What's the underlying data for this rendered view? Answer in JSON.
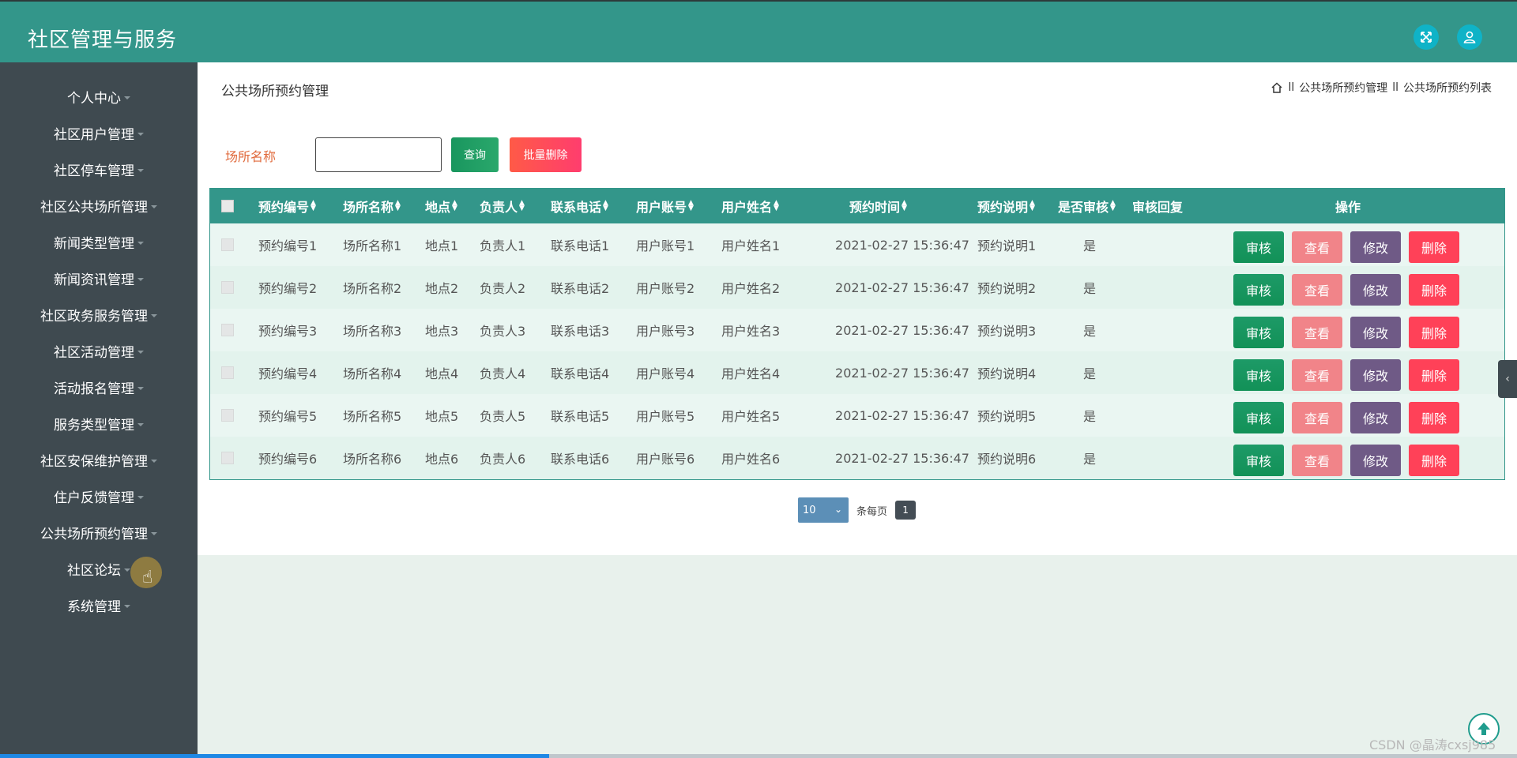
{
  "app": {
    "title": "社区管理与服务"
  },
  "header": {
    "icons": [
      "fullscreen-icon",
      "user-icon"
    ]
  },
  "sidebar": {
    "items": [
      {
        "label": "个人中心"
      },
      {
        "label": "社区用户管理"
      },
      {
        "label": "社区停车管理"
      },
      {
        "label": "社区公共场所管理"
      },
      {
        "label": "新闻类型管理"
      },
      {
        "label": "新闻资讯管理"
      },
      {
        "label": "社区政务服务管理"
      },
      {
        "label": "社区活动管理"
      },
      {
        "label": "活动报名管理"
      },
      {
        "label": "服务类型管理"
      },
      {
        "label": "社区安保维护管理"
      },
      {
        "label": "住户反馈管理"
      },
      {
        "label": "公共场所预约管理"
      },
      {
        "label": "社区论坛"
      },
      {
        "label": "系统管理"
      }
    ]
  },
  "page": {
    "heading": "公共场所预约管理",
    "breadcrumb": {
      "sep1": "ll",
      "item1": "公共场所预约管理",
      "sep2": "ll",
      "item2": "公共场所预约列表"
    }
  },
  "filter": {
    "label": "场所名称",
    "value": "",
    "query_label": "查询",
    "batch_delete_label": "批量删除"
  },
  "table": {
    "headers": [
      "预约编号",
      "场所名称",
      "地点",
      "负责人",
      "联系电话",
      "用户账号",
      "用户姓名",
      "预约时间",
      "预约说明",
      "是否审核",
      "审核回复",
      "操作"
    ],
    "actions": {
      "audit": "审核",
      "view": "查看",
      "edit": "修改",
      "delete": "删除"
    },
    "rows": [
      [
        "预约编号1",
        "场所名称1",
        "地点1",
        "负责人1",
        "联系电话1",
        "用户账号1",
        "用户姓名1",
        "2021-02-27 15:36:47",
        "预约说明1",
        "是",
        ""
      ],
      [
        "预约编号2",
        "场所名称2",
        "地点2",
        "负责人2",
        "联系电话2",
        "用户账号2",
        "用户姓名2",
        "2021-02-27 15:36:47",
        "预约说明2",
        "是",
        ""
      ],
      [
        "预约编号3",
        "场所名称3",
        "地点3",
        "负责人3",
        "联系电话3",
        "用户账号3",
        "用户姓名3",
        "2021-02-27 15:36:47",
        "预约说明3",
        "是",
        ""
      ],
      [
        "预约编号4",
        "场所名称4",
        "地点4",
        "负责人4",
        "联系电话4",
        "用户账号4",
        "用户姓名4",
        "2021-02-27 15:36:47",
        "预约说明4",
        "是",
        ""
      ],
      [
        "预约编号5",
        "场所名称5",
        "地点5",
        "负责人5",
        "联系电话5",
        "用户账号5",
        "用户姓名5",
        "2021-02-27 15:36:47",
        "预约说明5",
        "是",
        ""
      ],
      [
        "预约编号6",
        "场所名称6",
        "地点6",
        "负责人6",
        "联系电话6",
        "用户账号6",
        "用户姓名6",
        "2021-02-27 15:36:47",
        "预约说明6",
        "是",
        ""
      ]
    ]
  },
  "pager": {
    "page_size": "10",
    "per_page_label": "条每页",
    "current_page": "1"
  },
  "watermark": "CSDN @晶涛cxsj985",
  "colors": {
    "header": "#33968a",
    "sidebar": "#3f4a50",
    "accent_cyan": "#0fb3c7",
    "audit": "#129157",
    "view": "#f18489",
    "edit": "#6f5a86",
    "delete": "#ff4158"
  }
}
